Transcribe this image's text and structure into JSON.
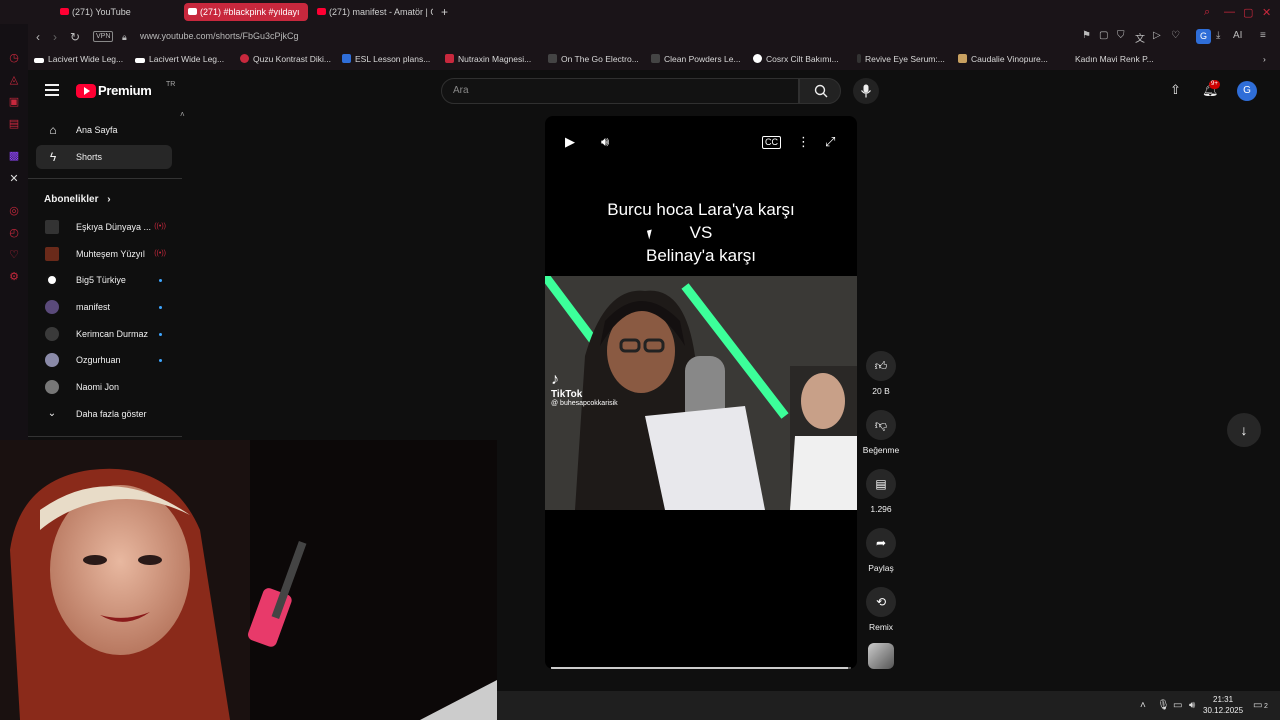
{
  "browser": {
    "tabs": [
      {
        "label": "(271) YouTube",
        "active": false
      },
      {
        "label": "(271) #blackpink #yıldayı",
        "active": true
      },
      {
        "label": "(271) manifest - Amatör | C",
        "active": false
      }
    ],
    "url": "www.youtube.com/shorts/FbGu3cPjkCg",
    "vpn_label": "VPN",
    "account_badge": "G",
    "ai_label": "AI",
    "bookmarks": [
      {
        "label": "Lacivert Wide Leg...",
        "color": "#ffffff"
      },
      {
        "label": "Lacivert Wide Leg...",
        "color": "#ffffff"
      },
      {
        "label": "Quzu Kontrast Diki...",
        "color": "#c8283d"
      },
      {
        "label": "ESL Lesson plans...",
        "color": "#2f6ed8"
      },
      {
        "label": "Nutraxin Magnesi...",
        "color": "#c8283d"
      },
      {
        "label": "On The Go Electro...",
        "color": "#444444"
      },
      {
        "label": "Clean Powders Le...",
        "color": "#444444"
      },
      {
        "label": "Cosrx Cilt Bakımı...",
        "color": "#ffffff"
      },
      {
        "label": "Revive Eye Serum:...",
        "color": "#333333"
      },
      {
        "label": "Caudalie Vinopure...",
        "color": "#c8a060"
      },
      {
        "label": "Kadın Mavi Renk P...",
        "color": "#1a1418"
      }
    ]
  },
  "header": {
    "logo_text": "Premium",
    "logo_region": "TR",
    "search_placeholder": "Ara",
    "notification_count": "9+",
    "avatar_letter": "G"
  },
  "sidebar": {
    "items": [
      {
        "label": "Ana Sayfa",
        "icon": "home-icon",
        "active": false
      },
      {
        "label": "Shorts",
        "icon": "shorts-icon",
        "active": true
      }
    ],
    "subscriptions_title": "Abonelikler",
    "subscriptions": [
      {
        "name": "Eşkıya Dünyaya ...",
        "live": "((•))",
        "color": "#333333"
      },
      {
        "name": "Muhteşem Yüzyıl",
        "live": "((•))",
        "color": "#6a2a1a"
      },
      {
        "name": "Big5 Türkiye",
        "live": "",
        "color": "#ffffff"
      },
      {
        "name": "manifest",
        "live": "",
        "color": "#5a4a7a"
      },
      {
        "name": "Kerimcan Durmaz",
        "live": "",
        "color": "#3a3a3a"
      },
      {
        "name": "Ozgurhuan",
        "live": "",
        "color": "#8a8aa8"
      },
      {
        "name": "Naomi Jon",
        "live": "",
        "color": "#777777"
      }
    ],
    "show_more": "Daha fazla göster"
  },
  "short": {
    "caption_lines": [
      "Burcu hoca Lara'ya karşı",
      "VS",
      "Belinay'a karşı"
    ],
    "watermark_brand": "TikTok",
    "watermark_handle": "@ buhesapcokkarisik",
    "progress": 0.99
  },
  "actions": {
    "like_count": "20 B",
    "dislike_label": "Beğenme",
    "comment_count": "1.296",
    "share_label": "Paylaş",
    "remix_label": "Remix"
  },
  "taskbar": {
    "time": "21:31",
    "date": "30.12.2025",
    "notification_count": "2"
  }
}
